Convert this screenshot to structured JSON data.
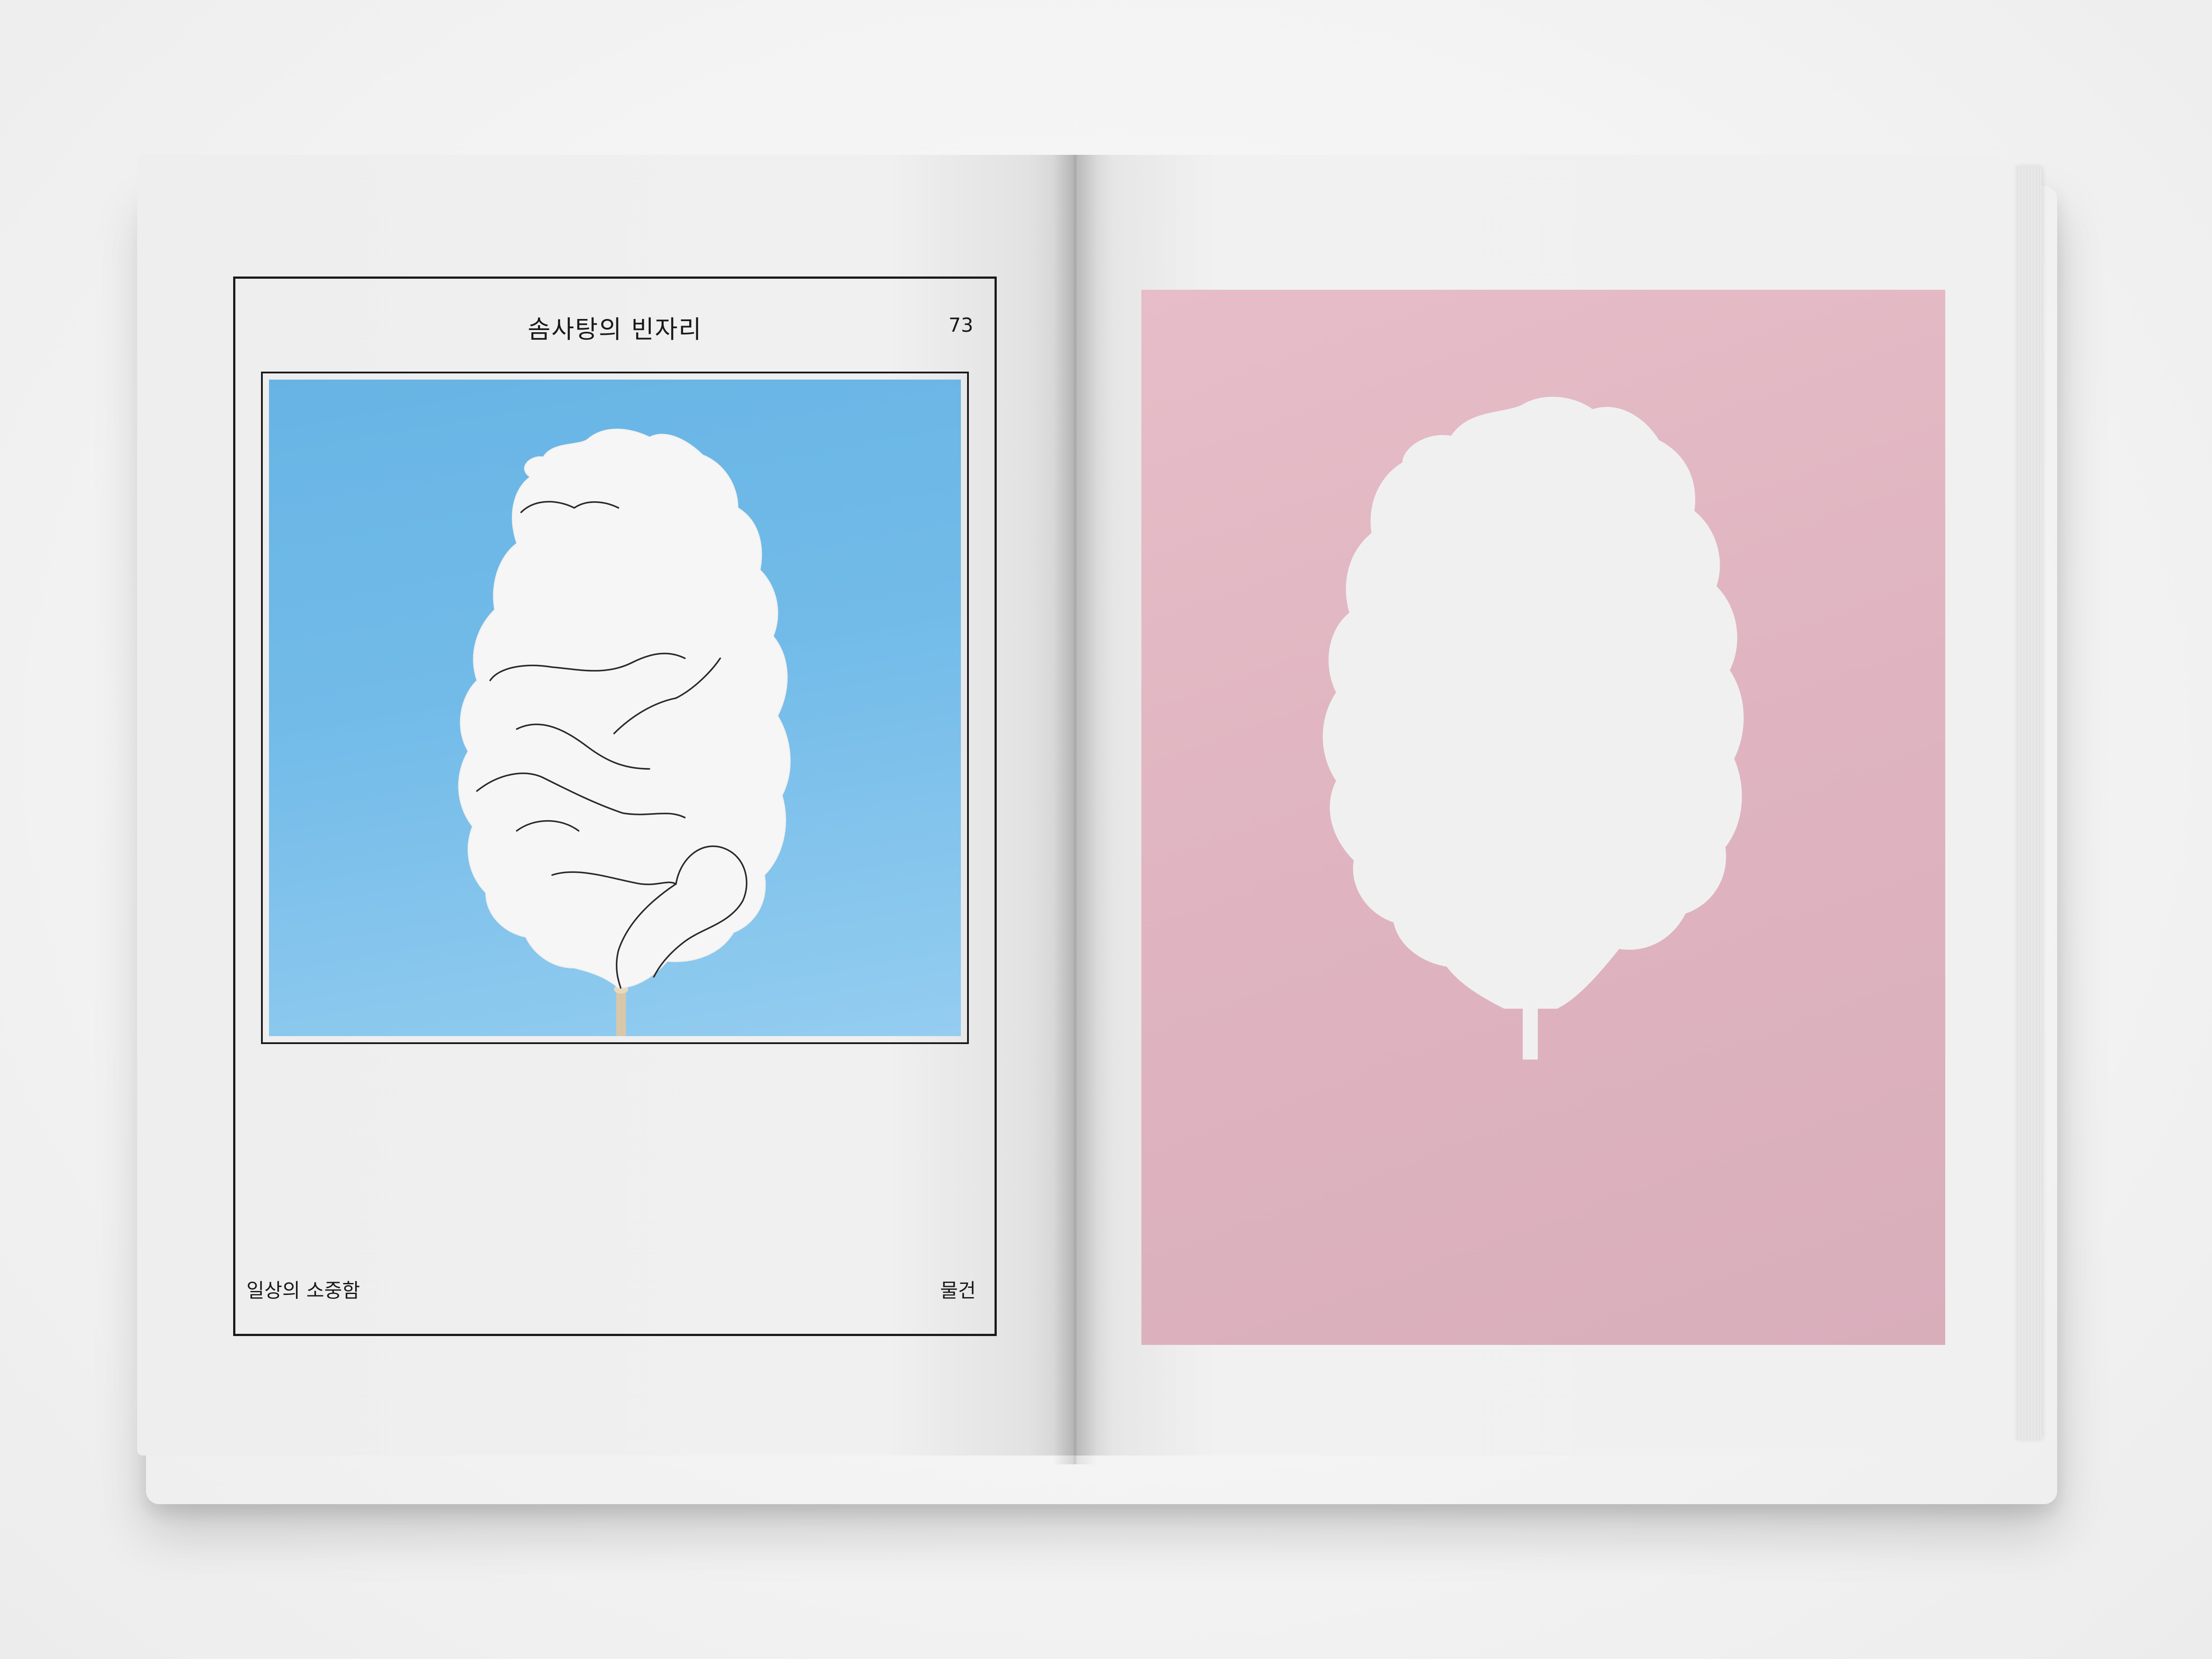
{
  "left_page": {
    "title": "솜사탕의 빈자리",
    "page_number": "73",
    "footer_left": "일상의 소중함",
    "footer_right": "물건"
  },
  "colors": {
    "sky_blue": "#6fb9e8",
    "pink_background": "#dfb4c0",
    "paper": "#f0f0f0",
    "ink": "#1a1a1a"
  }
}
